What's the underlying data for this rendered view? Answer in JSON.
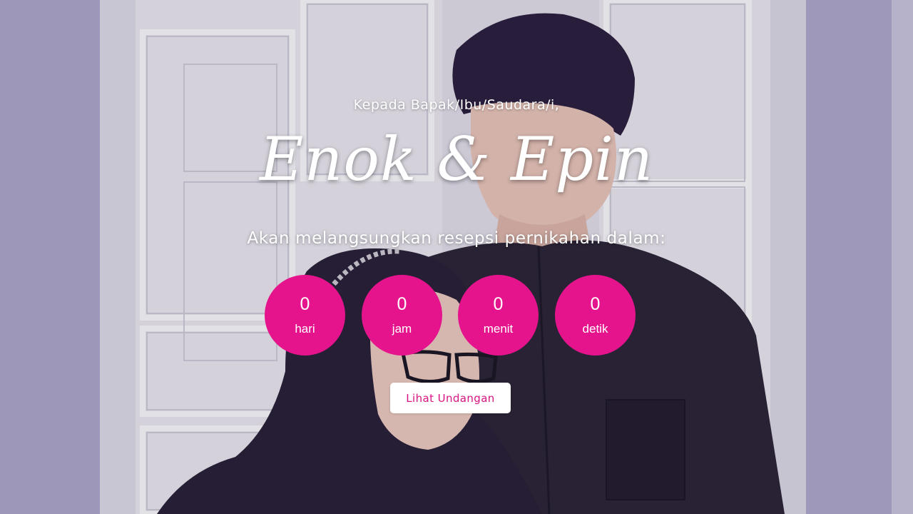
{
  "hero": {
    "greeting": "Kepada Bapak/Ibu/Saudara/i,",
    "couple_names": "Enok & Epin",
    "announcement": "Akan melangsungkan resepsi pernikahan dalam:",
    "background_image": "photo of couple in black outfits in front of white paneled wall"
  },
  "countdown": [
    {
      "value": "0",
      "unit": "hari"
    },
    {
      "value": "0",
      "unit": "jam"
    },
    {
      "value": "0",
      "unit": "menit"
    },
    {
      "value": "0",
      "unit": "detik"
    }
  ],
  "button": {
    "label": "Lihat Undangan"
  },
  "colors": {
    "accent": "#e5148c",
    "button_text": "#d81380",
    "text": "#ffffff"
  }
}
